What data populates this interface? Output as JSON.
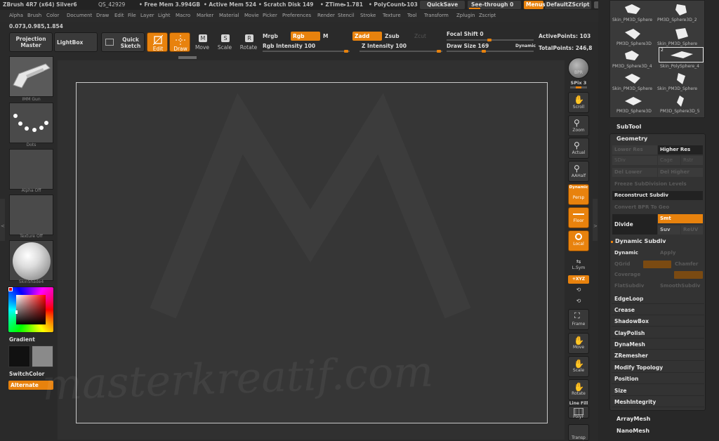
{
  "title_bar": {
    "app": "ZBrush 4R7 (x64) Silver6",
    "qs": "QS_42929",
    "free_mem": "• Free Mem 3.994GB",
    "active_mem": "• Active Mem 524",
    "scratch": "• Scratch Disk 149",
    "ztime": "• ZTime▸1.781",
    "polycount": "• PolyCount▸103",
    "quicksave": "QuickSave",
    "see_through": "See-through  0",
    "menus": "Menus",
    "default_zscript": "DefaultZScript"
  },
  "menubar": [
    "Alpha",
    "Brush",
    "Color",
    "Document",
    "Draw",
    "Edit",
    "File",
    "Layer",
    "Light",
    "Macro",
    "Marker",
    "Material",
    "Movie",
    "Picker",
    "Preferences",
    "Render",
    "Stencil",
    "Stroke",
    "Texture",
    "Tool",
    "Transform",
    "Zplugin",
    "Zscript"
  ],
  "coords": "0.073,0.985,1.854",
  "toolbar": {
    "projection_master": "Projection Master",
    "lightbox": "LightBox",
    "quick_sketch": "Quick Sketch",
    "edit": "Edit",
    "draw": "Draw",
    "move": "Move",
    "scale": "Scale",
    "rotate": "Rotate",
    "mrgb": "Mrgb",
    "rgb": "Rgb",
    "m": "M",
    "zadd": "Zadd",
    "zsub": "Zsub",
    "zcut": "Zcut",
    "rgb_intensity": "Rgb Intensity 100",
    "z_intensity": "Z Intensity 100",
    "focal_shift": "Focal Shift 0",
    "draw_size": "Draw Size 169",
    "dynamic": "Dynamic",
    "active_points": "ActivePoints: 103",
    "total_points": "TotalPoints: 246,8"
  },
  "left_panel": {
    "brush_label": "IMM Gun",
    "dots_label": "Dots",
    "alpha_label": "Alpha Off",
    "texture_label": "Texture Off",
    "material_label": "SkinShade4",
    "gradient": "Gradient",
    "switchcolor": "SwitchColor",
    "alternate": "Alternate"
  },
  "right_shelf": {
    "bpr": "BPR",
    "spix": "SPix 3",
    "scroll": "Scroll",
    "zoom": "Zoom",
    "actual": "Actual",
    "aahalf": "AAHalf",
    "dynamic": "Dynamic",
    "persp": "Persp",
    "floor": "Floor",
    "local": "Local",
    "lsym": "L.Sym",
    "xyz": "✳XYZ",
    "frame": "Frame",
    "move": "Move",
    "scale": "Scale",
    "rotate": "Rotate",
    "linefill": "Line Fill",
    "polyf": "PolyF",
    "transp": "Transp"
  },
  "tool_thumbnails": [
    {
      "label": "Skin_PM3D_Sphere"
    },
    {
      "label": "PM3D_Sphere3D_2"
    },
    {
      "label": "PM3D_Sphere3D"
    },
    {
      "label": "Skin_PM3D_Sphere"
    },
    {
      "label": "PM3D_Sphere3D_4"
    },
    {
      "label": "Skin_PolySphere_4"
    },
    {
      "label": "Skin_PM3D_Sphere"
    },
    {
      "label": "Skin_PM3D_Sphere"
    },
    {
      "label": "PM3D_Sphere3D"
    },
    {
      "label": "PM3D_Sphere3D_5"
    }
  ],
  "thumb_badge": "2",
  "tool_panel": {
    "subtool": "SubTool",
    "geometry": "Geometry",
    "lower_res": "Lower Res",
    "higher_res": "Higher Res",
    "sdiv": "SDiv",
    "cage": "Cage",
    "rstr": "Rstr",
    "del_lower": "Del Lower",
    "del_higher": "Del Higher",
    "freeze": "Freeze SubDivision Levels",
    "reconstruct": "Reconstruct Subdiv",
    "convert_bpr": "Convert BPR To Geo",
    "divide": "Divide",
    "smt": "Smt",
    "suv": "Suv",
    "reuv": "ReUV",
    "dynamic_subdiv": "Dynamic Subdiv",
    "dynamic": "Dynamic",
    "apply": "Apply",
    "qgrid": "QGrid",
    "chamfer": "Chamfer",
    "coverage": "Coverage",
    "flatsubdiv": "FlatSubdiv",
    "smoothsubdiv": "SmoothSubdiv",
    "items": [
      "EdgeLoop",
      "Crease",
      "ShadowBox",
      "ClayPolish",
      "DynaMesh",
      "ZRemesher",
      "Modify Topology",
      "Position",
      "Size",
      "MeshIntegrity"
    ],
    "arraymesh": "ArrayMesh",
    "nanomesh": "NanoMesh"
  },
  "watermark": "masterkreatif.com",
  "colors": {
    "accent": "#e8820d",
    "bg": "#2a2a2a",
    "canvas": "#343434"
  }
}
